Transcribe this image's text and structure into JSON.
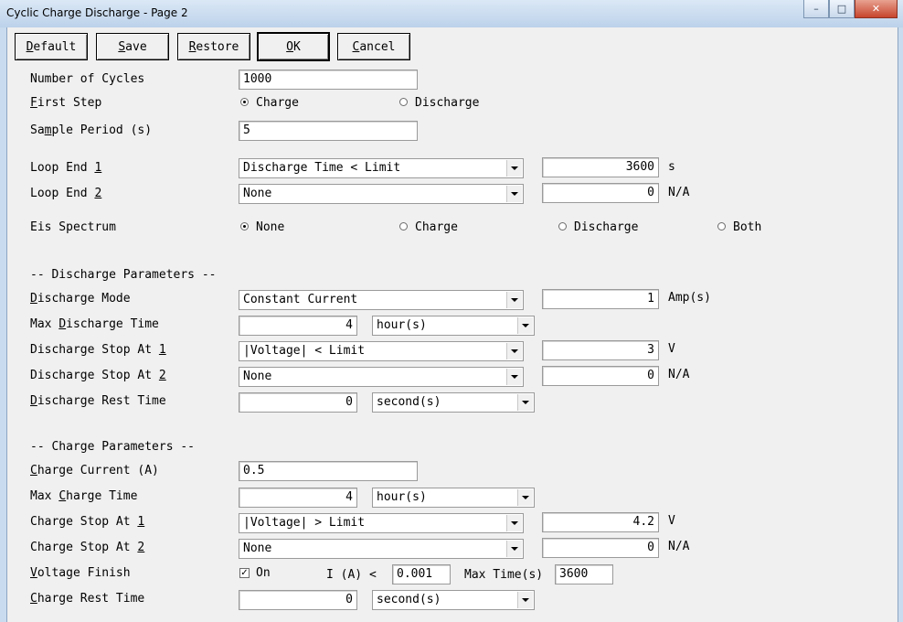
{
  "window": {
    "title": "Cyclic Charge Discharge - Page 2",
    "minimize": "–",
    "maximize": "□",
    "close": "✕"
  },
  "toolbar": {
    "default": {
      "pre": "",
      "u": "D",
      "post": "efault"
    },
    "save": {
      "pre": "",
      "u": "S",
      "post": "ave"
    },
    "restore": {
      "pre": "",
      "u": "R",
      "post": "estore"
    },
    "ok": {
      "pre": "",
      "u": "O",
      "post": "K"
    },
    "cancel": {
      "pre": "",
      "u": "C",
      "post": "ancel"
    }
  },
  "general": {
    "cycles_label": "Number of Cycles",
    "cycles_value": "1000",
    "first_step_label": {
      "pre": "",
      "u": "F",
      "post": "irst Step"
    },
    "first_step_charge": "Charge",
    "first_step_discharge": "Discharge",
    "sample_label": {
      "pre": "Sa",
      "u": "m",
      "post": "ple Period (s)"
    },
    "sample_value": "5",
    "loop1_label": {
      "pre": "Loop End ",
      "u": "1",
      "post": ""
    },
    "loop1_select": "Discharge Time < Limit",
    "loop1_value": "3600",
    "loop1_unit": "s",
    "loop2_label": {
      "pre": "Loop End ",
      "u": "2",
      "post": ""
    },
    "loop2_select": "None",
    "loop2_value": "0",
    "loop2_unit": "N/A",
    "eis_label": "Eis Spectrum",
    "eis_none": "None",
    "eis_charge": "Charge",
    "eis_discharge": "Discharge",
    "eis_both": "Both"
  },
  "discharge": {
    "header": "-- Discharge Parameters --",
    "mode_label": {
      "pre": "",
      "u": "D",
      "post": "ischarge Mode"
    },
    "mode_select": "Constant Current",
    "mode_value": "1",
    "mode_unit": "Amp(s)",
    "max_label": {
      "pre": "Max ",
      "u": "D",
      "post": "ischarge Time"
    },
    "max_value": "4",
    "max_unit_select": "hour(s)",
    "stop1_label": {
      "pre": "Discharge Stop At ",
      "u": "1",
      "post": ""
    },
    "stop1_select": "|Voltage| < Limit",
    "stop1_value": "3",
    "stop1_unit": "V",
    "stop2_label": {
      "pre": "Discharge Stop At ",
      "u": "2",
      "post": ""
    },
    "stop2_select": "None",
    "stop2_value": "0",
    "stop2_unit": "N/A",
    "rest_label": {
      "pre": "",
      "u": "D",
      "post": "ischarge Rest Time"
    },
    "rest_value": "0",
    "rest_unit_select": "second(s)"
  },
  "charge": {
    "header": "-- Charge Parameters --",
    "current_label": {
      "pre": "",
      "u": "C",
      "post": "harge Current (A)"
    },
    "current_value": "0.5",
    "max_label": {
      "pre": "Max ",
      "u": "C",
      "post": "harge Time"
    },
    "max_value": "4",
    "max_unit_select": "hour(s)",
    "stop1_label": {
      "pre": "Charge Stop At ",
      "u": "1",
      "post": ""
    },
    "stop1_select": "|Voltage| > Limit",
    "stop1_value": "4.2",
    "stop1_unit": "V",
    "stop2_label": {
      "pre": "Charge Stop At ",
      "u": "2",
      "post": ""
    },
    "stop2_select": "None",
    "stop2_value": "0",
    "stop2_unit": "N/A",
    "vfinish_label": {
      "pre": "",
      "u": "V",
      "post": "oltage Finish"
    },
    "vfinish_on": "On",
    "vfinish_i_label": "I (A) <",
    "vfinish_i_value": "0.001",
    "vfinish_max_label": "Max Time(s)",
    "vfinish_max_value": "3600",
    "rest_label": {
      "pre": "",
      "u": "C",
      "post": "harge Rest Time"
    },
    "rest_value": "0",
    "rest_unit_select": "second(s)"
  }
}
